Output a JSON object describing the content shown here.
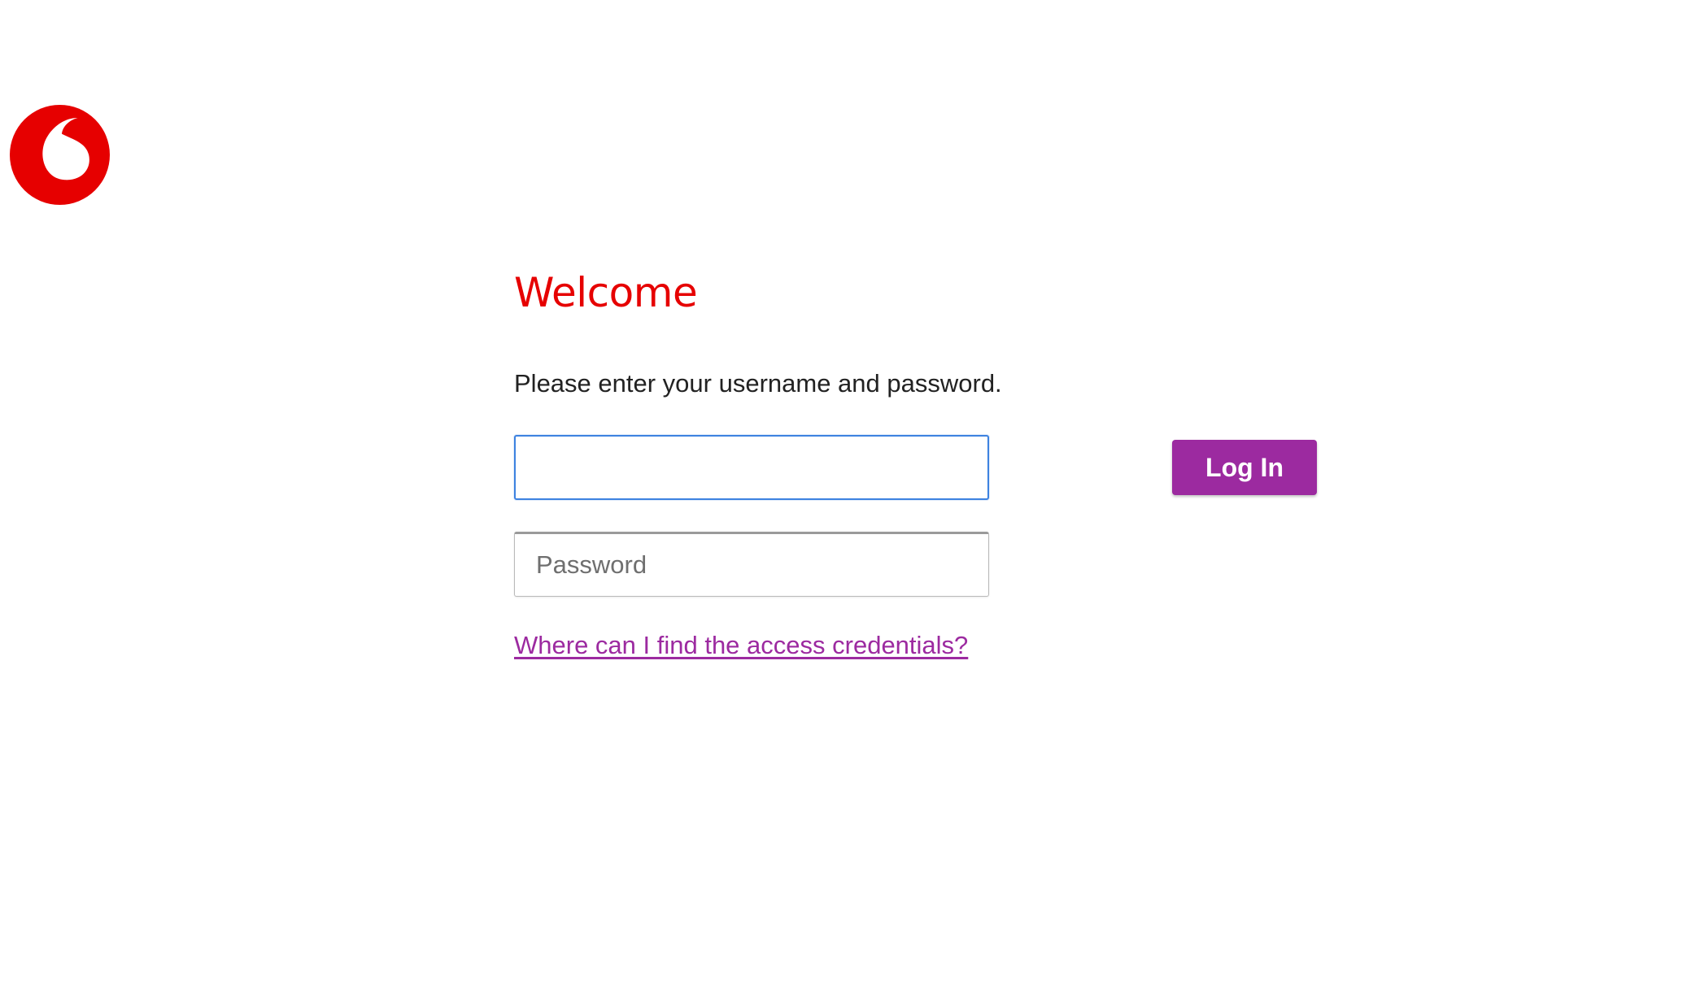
{
  "brand": {
    "logo_icon": "vodafone-speechmark-icon",
    "accent_color": "#e60000",
    "primary_color": "#9c2aa0"
  },
  "login": {
    "title": "Welcome",
    "instructions": "Please enter your username and password.",
    "username": {
      "value": "",
      "placeholder": "",
      "focused": true
    },
    "password": {
      "value": "",
      "placeholder": "Password"
    },
    "submit_label": "Log In",
    "help_link_label": "Where can I find the access credentials?"
  }
}
